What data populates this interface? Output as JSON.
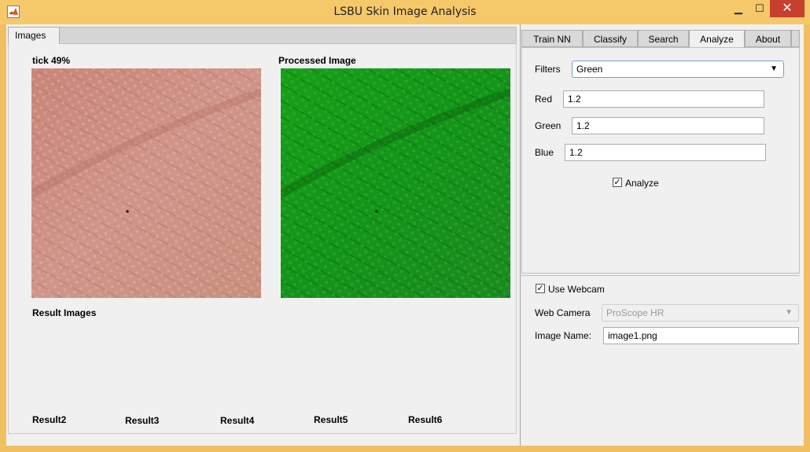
{
  "window": {
    "title": "LSBU Skin Image Analysis",
    "min": "▁",
    "max": "☐",
    "close": "✕"
  },
  "left": {
    "tab_label": "Images",
    "original_label": "tick 49%",
    "processed_label": "Processed Image",
    "result_images_label": "Result Images",
    "results": [
      "Result2",
      "Result3",
      "Result4",
      "Result5",
      "Result6"
    ]
  },
  "right": {
    "tabs": [
      "Train NN",
      "Classify",
      "Search",
      "Analyze",
      "About"
    ],
    "active_tab": "Analyze",
    "filters_label": "Filters",
    "filters_value": "Green",
    "red_label": "Red",
    "red_value": "1.2",
    "green_label": "Green",
    "green_value": "1.2",
    "blue_label": "Blue",
    "blue_value": "1.2",
    "analyze_label": "Analyze",
    "analyze_checked": true,
    "use_webcam_label": "Use Webcam",
    "use_webcam_checked": true,
    "web_camera_label": "Web Camera",
    "web_camera_value": "ProScope HR",
    "image_name_label": "Image Name:",
    "image_name_value": "image1.png"
  },
  "colors": {
    "title_bar": "#f5c86a",
    "close_button": "#c7402f",
    "skin": "#c88878",
    "processed": "#1a9a1a"
  }
}
